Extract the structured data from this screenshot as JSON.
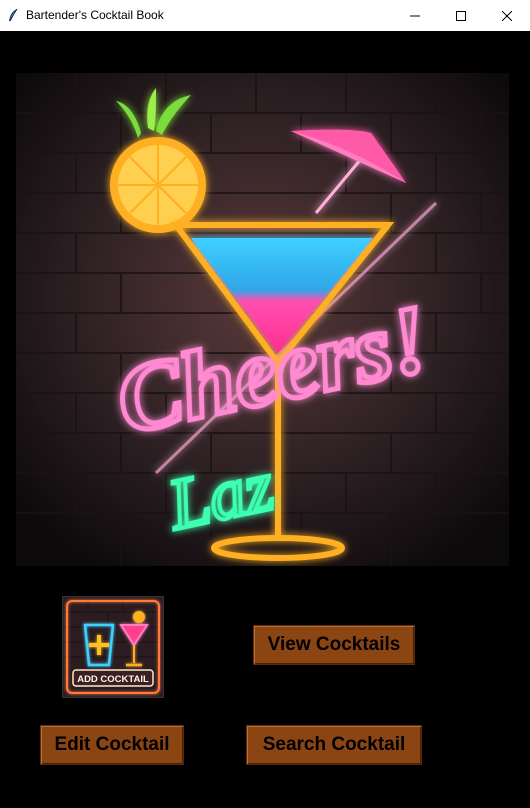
{
  "window": {
    "title": "Bartender's Cocktail Book",
    "icon": "feather-icon"
  },
  "controls": {
    "minimize_icon": "minimize-icon",
    "maximize_icon": "maximize-icon",
    "close_icon": "close-icon"
  },
  "poster": {
    "sign_text": "Cheers!",
    "script_text": "Laz"
  },
  "buttons": {
    "add_label": "ADD COCKTAIL",
    "view_label": "View Cocktails",
    "edit_label": "Edit Cocktail",
    "search_label": "Search Cocktail"
  },
  "colors": {
    "button_bg": "#8b4513",
    "background": "#000000",
    "neon_pink": "#ff6ec7",
    "neon_green": "#3cffb0",
    "neon_yellow": "#ffc020"
  }
}
